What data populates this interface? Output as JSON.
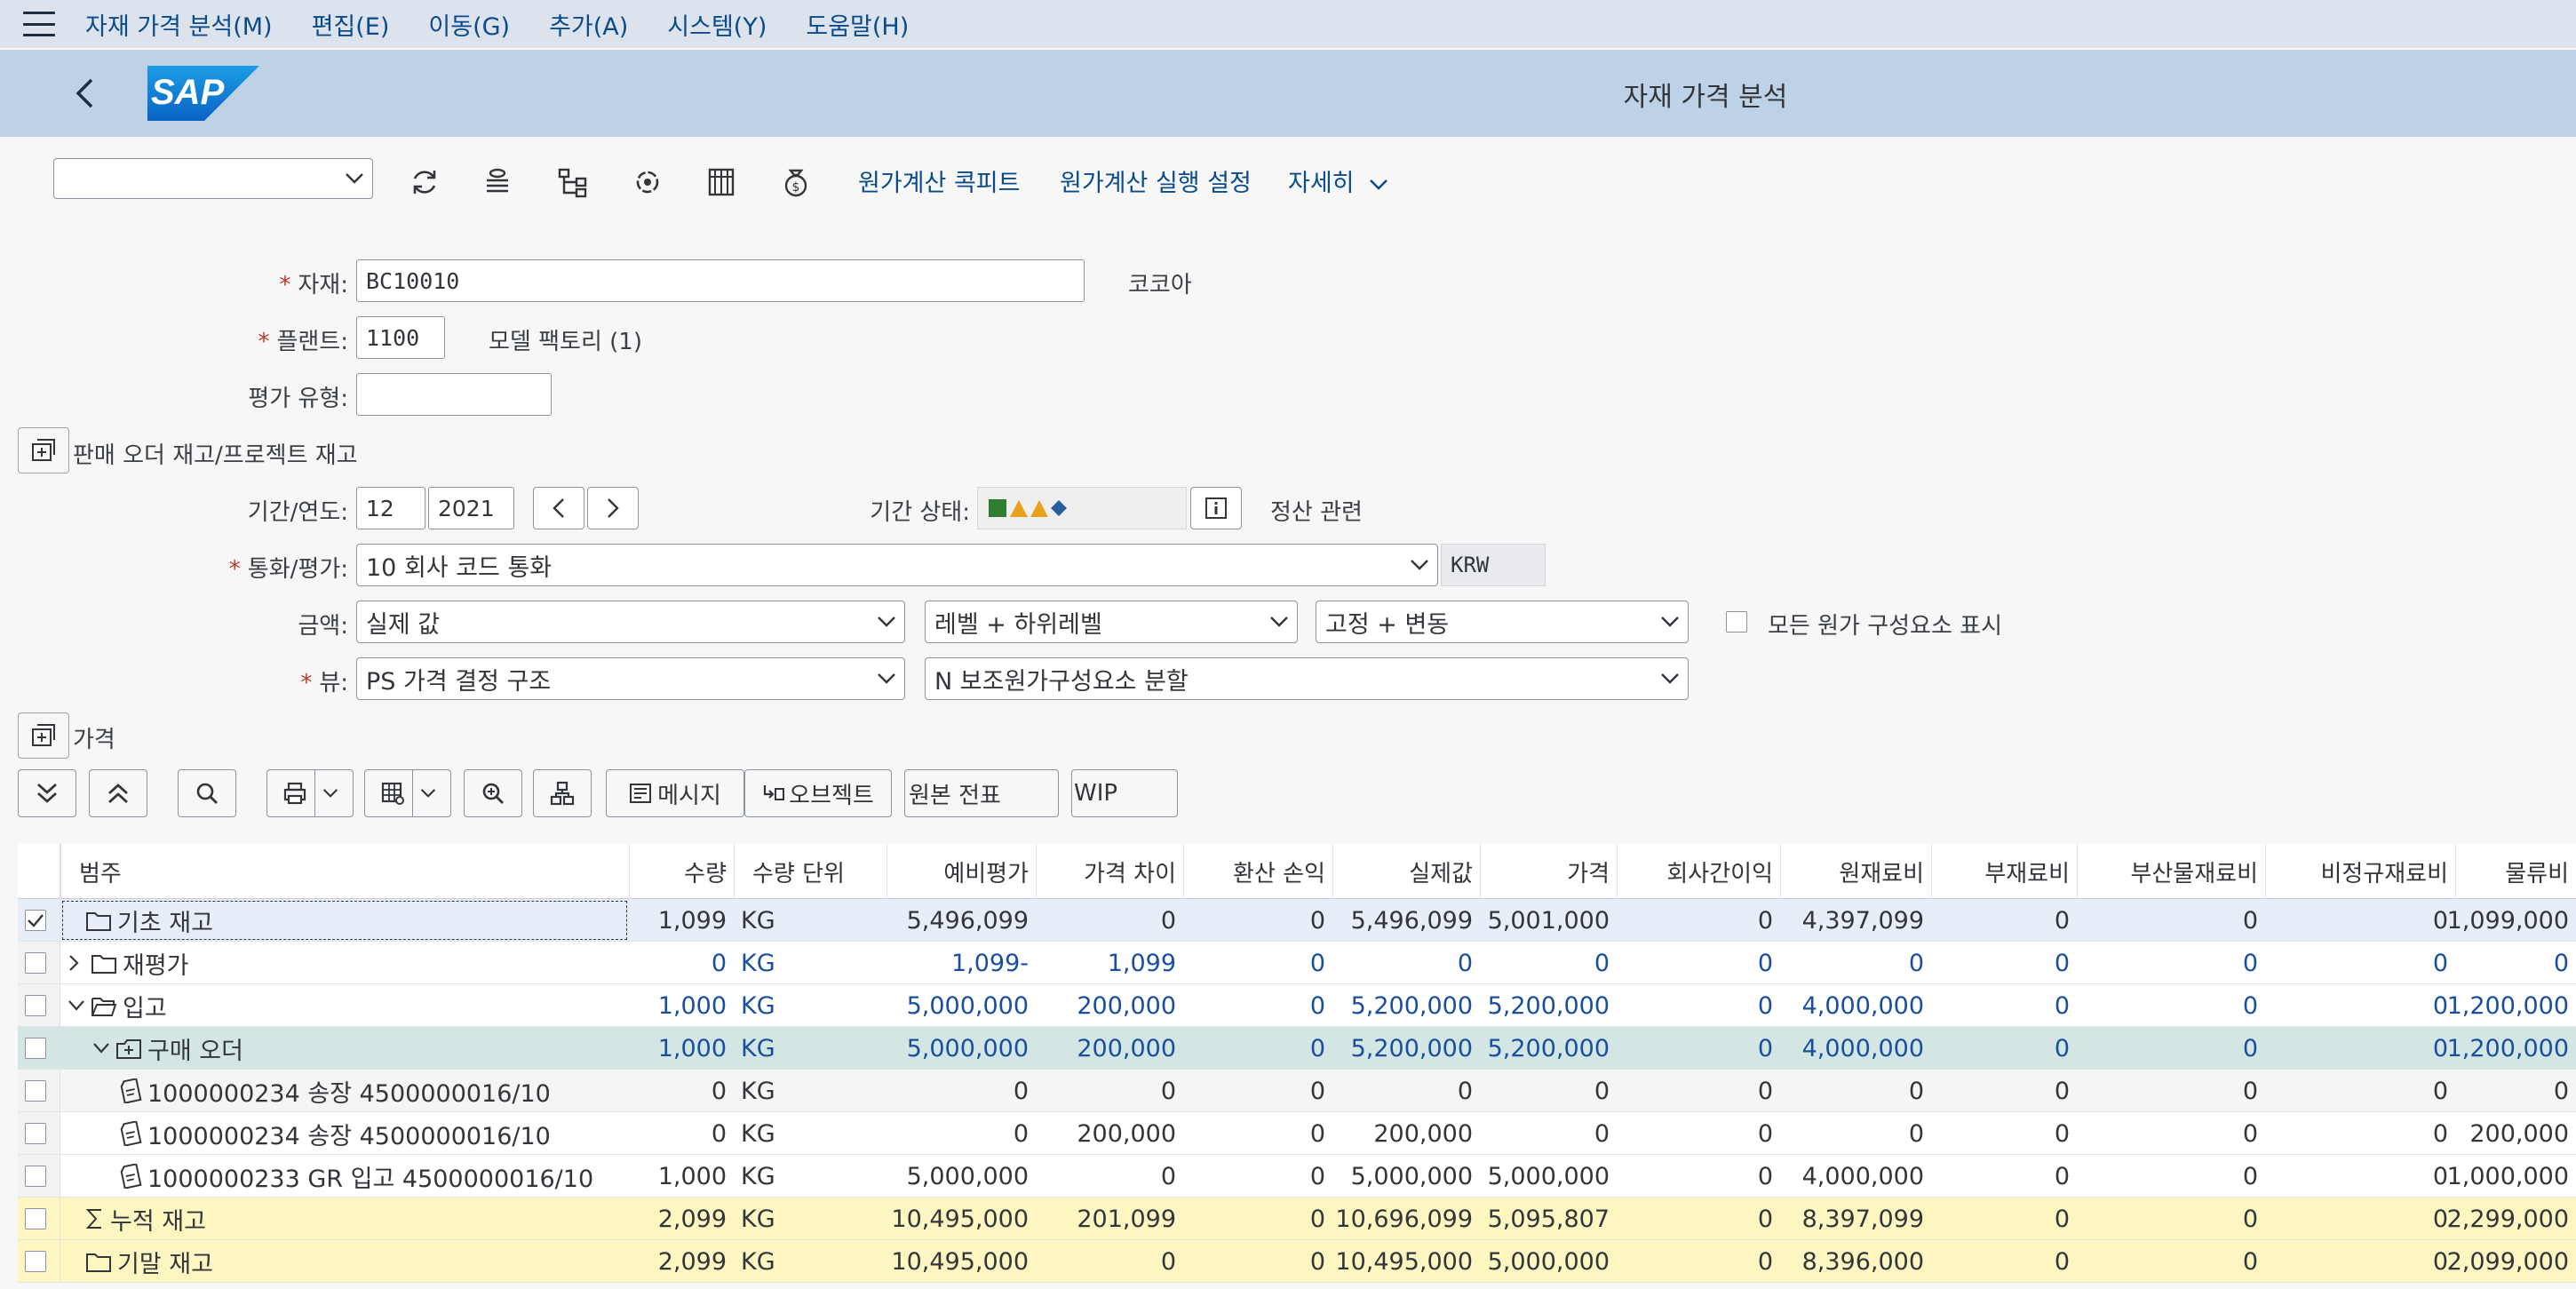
{
  "menu": [
    "자재 가격 분석(M)",
    "편집(E)",
    "이동(G)",
    "추가(A)",
    "시스템(Y)",
    "도움말(H)"
  ],
  "title": "자재 가격 분석",
  "logo_text": "SAP",
  "toolbar": {
    "combo_value": "",
    "cost_cockpit": "원가계산 콕피트",
    "cost_run_settings": "원가계산 실행 설정",
    "more": "자세히"
  },
  "form": {
    "material_label": "자재:",
    "material_value": "BC10010",
    "material_desc": "코코아",
    "plant_label": "플랜트:",
    "plant_value": "1100",
    "plant_desc": "모델 팩토리 (1)",
    "valuation_label": "평가 유형:",
    "valuation_value": "",
    "sales_order_section": "판매 오더 재고/프로젝트 재고",
    "period_label": "기간/연도:",
    "period_value": "12",
    "year_value": "2021",
    "period_status_label": "기간 상태:",
    "settlement": "정산 관련",
    "currency_label": "통화/평가:",
    "currency_value": "10 회사 코드 통화",
    "currency_code": "KRW",
    "amount_label": "금액:",
    "amount_value": "실제 값",
    "level_value": "레벨 + 하위레벨",
    "fixvar_value": "고정 + 변동",
    "show_all_components": "모든 원가 구성요소 표시",
    "view_label": "뷰:",
    "view_value": "PS 가격 결정 구조",
    "split_value": "N 보조원가구성요소 분할",
    "price_section": "가격"
  },
  "table_toolbar": {
    "messages": "메시지",
    "object": "오브젝트",
    "original_doc": "원본 전표",
    "wip": "WIP"
  },
  "table": {
    "headers": [
      "범주",
      "수량",
      "수량 단위",
      "예비평가",
      "가격 차이",
      "환산 손익",
      "실제값",
      "가격",
      "회사간이익",
      "원재료비",
      "부재료비",
      "부산물재료비",
      "비정규재료비",
      "물류비"
    ],
    "rows": [
      {
        "cat": "기초 재고",
        "cells": [
          "1,099",
          "KG",
          "5,496,099",
          "0",
          "0",
          "5,496,099",
          "5,001,000",
          "0",
          "4,397,099",
          "0",
          "0",
          "0",
          "1,099,000"
        ]
      },
      {
        "cat": "재평가",
        "cells": [
          "0",
          "KG",
          "1,099-",
          "1,099",
          "0",
          "0",
          "0",
          "0",
          "0",
          "0",
          "0",
          "0",
          "0"
        ]
      },
      {
        "cat": "입고",
        "cells": [
          "1,000",
          "KG",
          "5,000,000",
          "200,000",
          "0",
          "5,200,000",
          "5,200,000",
          "0",
          "4,000,000",
          "0",
          "0",
          "0",
          "1,200,000"
        ]
      },
      {
        "cat": "구매 오더",
        "cells": [
          "1,000",
          "KG",
          "5,000,000",
          "200,000",
          "0",
          "5,200,000",
          "5,200,000",
          "0",
          "4,000,000",
          "0",
          "0",
          "0",
          "1,200,000"
        ]
      },
      {
        "cat": "1000000234 송장 4500000016/10",
        "cells": [
          "0",
          "KG",
          "0",
          "0",
          "0",
          "0",
          "0",
          "0",
          "0",
          "0",
          "0",
          "0",
          "0"
        ]
      },
      {
        "cat": "1000000234 송장 4500000016/10",
        "cells": [
          "0",
          "KG",
          "0",
          "200,000",
          "0",
          "200,000",
          "0",
          "0",
          "0",
          "0",
          "0",
          "0",
          "200,000"
        ]
      },
      {
        "cat": "1000000233 GR 입고 4500000016/10",
        "cells": [
          "1,000",
          "KG",
          "5,000,000",
          "0",
          "0",
          "5,000,000",
          "5,000,000",
          "0",
          "4,000,000",
          "0",
          "0",
          "0",
          "1,000,000"
        ]
      },
      {
        "cat": "누적 재고",
        "cells": [
          "2,099",
          "KG",
          "10,495,000",
          "201,099",
          "0",
          "10,696,099",
          "5,095,807",
          "0",
          "8,397,099",
          "0",
          "0",
          "0",
          "2,299,000"
        ]
      },
      {
        "cat": "기말 재고",
        "cells": [
          "2,099",
          "KG",
          "10,495,000",
          "0",
          "0",
          "10,495,000",
          "5,000,000",
          "0",
          "8,396,000",
          "0",
          "0",
          "0",
          "2,099,000"
        ]
      }
    ]
  },
  "colors": {
    "menubar": "#dce3ec",
    "titlebar": "#bdd2e6",
    "link": "#0a4b8c",
    "value_blue": "#1a4fa0",
    "row_selected": "#e8eef7",
    "row_teal": "#d3e6e4",
    "row_yellow": "#fdf6c1",
    "status_green": "#2e7d32",
    "status_orange": "#e8a21a",
    "status_blue": "#2a5d9f"
  }
}
